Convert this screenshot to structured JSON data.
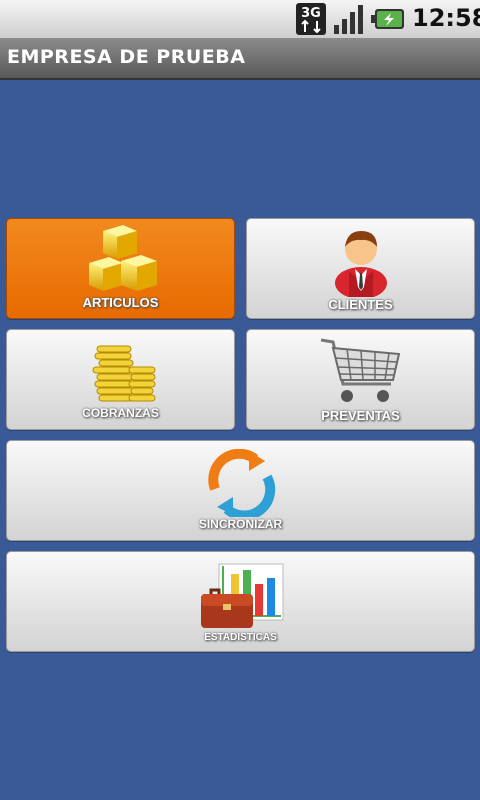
{
  "status_bar": {
    "network": "3G",
    "time": "12:58"
  },
  "app": {
    "title": "EMPRESA DE PRUEBA"
  },
  "menu": [
    {
      "label": "ARTICULOS",
      "icon": "boxes-icon",
      "selected": true
    },
    {
      "label": "CLIENTES",
      "icon": "client-person-icon",
      "selected": false
    },
    {
      "label": "COBRANZAS",
      "icon": "coins-icon",
      "selected": false
    },
    {
      "label": "PREVENTAS",
      "icon": "shopping-cart-icon",
      "selected": false
    },
    {
      "label": "SINCRONIZAR",
      "icon": "sync-arrows-icon",
      "selected": false
    },
    {
      "label": "ESTADISTICAS",
      "icon": "briefcase-chart-icon",
      "selected": false
    }
  ],
  "colors": {
    "background": "#3a5a97",
    "selected_tile": "#e86a00",
    "tile": "#e6e6e6"
  }
}
